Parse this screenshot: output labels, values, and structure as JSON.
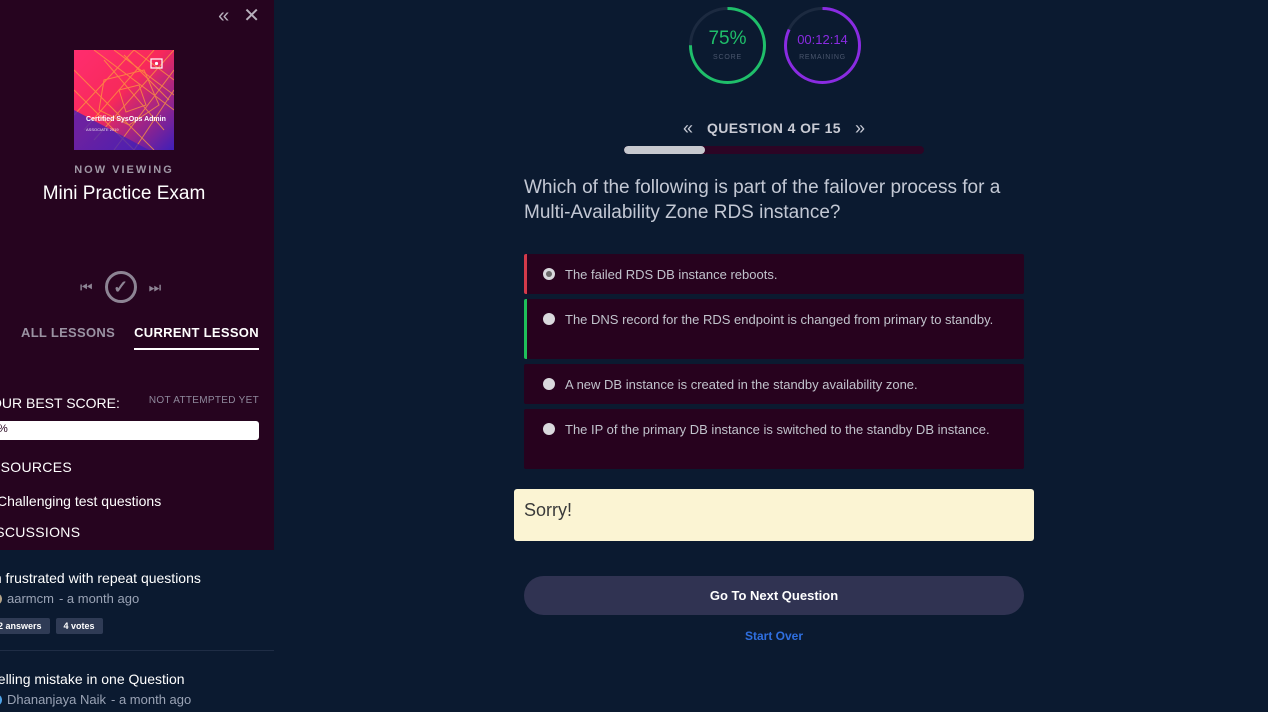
{
  "sidebar": {
    "course_cover": {
      "title": "Certified SysOps Admin",
      "subtitle": "ASSOCIATE 2019"
    },
    "now_viewing_label": "NOW VIEWING",
    "lesson_title": "Mini Practice Exam",
    "tabs": [
      {
        "label": "ALL LESSONS",
        "active": false
      },
      {
        "label": "CURRENT LESSON",
        "active": true
      }
    ],
    "best_score_label": "OUR BEST SCORE:",
    "best_score_status": "NOT ATTEMPTED YET",
    "best_score_bar_text": "%",
    "resources_heading": "ESOURCES",
    "resource_link": "Challenging test questions",
    "discussions_heading": "ISCUSSIONS",
    "discussions": [
      {
        "title": "m frustrated with repeat questions",
        "author": "aarmcm",
        "time": "- a month ago",
        "answers": "2 answers",
        "votes": "4 votes",
        "avatar_color": "#b5a58a"
      },
      {
        "title": "pelling mistake in one Question",
        "author": "Dhananjaya Naik",
        "time": "- a month ago",
        "avatar_color": "#4ea3e8"
      }
    ]
  },
  "quiz": {
    "score": {
      "value": "75%",
      "label": "SCORE",
      "fraction": 0.75,
      "color": "#1fbf6a"
    },
    "remaining": {
      "value": "00:12:14",
      "label": "REMAINING",
      "fraction": 0.82,
      "color": "#8a2be2"
    },
    "question_counter": "QUESTION 4 OF 15",
    "progress_fraction": 0.27,
    "question_text": "Which of the following is part of the failover process for a Multi-Availability Zone RDS instance?",
    "answers": [
      {
        "text": "The failed RDS DB instance reboots.",
        "state": "wrong",
        "selected": true
      },
      {
        "text": "The DNS record for the RDS endpoint is changed from primary to standby.",
        "state": "right",
        "selected": false
      },
      {
        "text": "A new DB instance is created in the standby availability zone.",
        "state": "none",
        "selected": false
      },
      {
        "text": "The IP of the primary DB instance is switched to the standby DB instance.",
        "state": "none",
        "selected": false
      }
    ],
    "feedback": "Sorry!",
    "next_button": "Go To Next Question",
    "start_over": "Start Over"
  },
  "colors": {
    "sidebar_bg": "#26041f",
    "main_bg": "#0b1a30",
    "answer_bg": "#27021e",
    "wrong": "#d43a4a",
    "right": "#1fbf5a",
    "link": "#2f6fe0"
  },
  "icons": {
    "collapse": "double-chevron-left-icon",
    "close": "close-icon",
    "skip_back": "skip-back-icon",
    "complete": "check-circle-icon",
    "skip_forward": "skip-forward-icon",
    "prev_question": "double-chevron-left-icon",
    "next_question": "double-chevron-right-icon"
  }
}
